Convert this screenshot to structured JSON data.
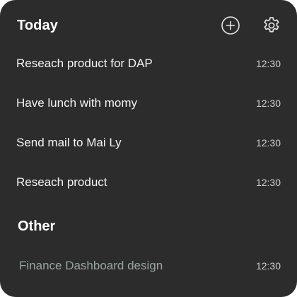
{
  "today": {
    "title": "Today",
    "add_icon": "plus-circle-icon",
    "settings_icon": "gear-icon",
    "tasks": [
      {
        "title": "Reseach product for DAP",
        "time": "12:30"
      },
      {
        "title": "Have lunch with momy",
        "time": "12:30"
      },
      {
        "title": "Send mail to Mai Ly",
        "time": "12:30"
      },
      {
        "title": "Reseach product",
        "time": "12:30"
      }
    ]
  },
  "other": {
    "title": "Other",
    "tasks": [
      {
        "title": "Finance Dashboard design",
        "time": "12:30"
      }
    ]
  },
  "colors": {
    "card_background": "#2c2c2c",
    "primary_text": "#ffffff",
    "muted_task_text": "#9aa3a0",
    "time_text": "#cfcfcf"
  }
}
